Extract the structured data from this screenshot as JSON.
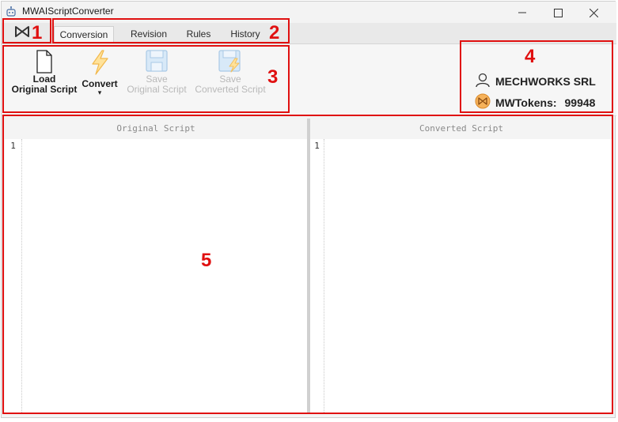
{
  "window": {
    "title": "MWAIScriptConverter",
    "minimize_icon": "minimize-icon",
    "maximize_icon": "maximize-icon",
    "close_icon": "close-icon"
  },
  "tabs": [
    {
      "label": "Conversion",
      "active": true
    },
    {
      "label": "Revision",
      "active": false
    },
    {
      "label": "Rules",
      "active": false
    },
    {
      "label": "History",
      "active": false
    }
  ],
  "toolbar": {
    "load": {
      "line1": "Load",
      "line2": "Original Script",
      "icon": "document-icon"
    },
    "convert": {
      "line1": "Convert",
      "arrow": "▾",
      "icon": "lightning-icon"
    },
    "save_original": {
      "line1": "Save",
      "line2": "Original Script",
      "icon": "floppy-disk-icon"
    },
    "save_converted": {
      "line1": "Save",
      "line2": "Converted Script",
      "icon": "floppy-disk-lightning-icon"
    }
  },
  "account": {
    "user_name": "MECHWORKS SRL",
    "tokens_label": "MWTokens:",
    "tokens_value": "99948"
  },
  "editors": {
    "original": {
      "header": "Original Script",
      "line_number": "1"
    },
    "converted": {
      "header": "Converted Script",
      "line_number": "1"
    }
  },
  "annotations": [
    "1",
    "2",
    "3",
    "4",
    "5"
  ],
  "colors": {
    "annotation": "#e01010",
    "token_badge": "#f0a040"
  }
}
